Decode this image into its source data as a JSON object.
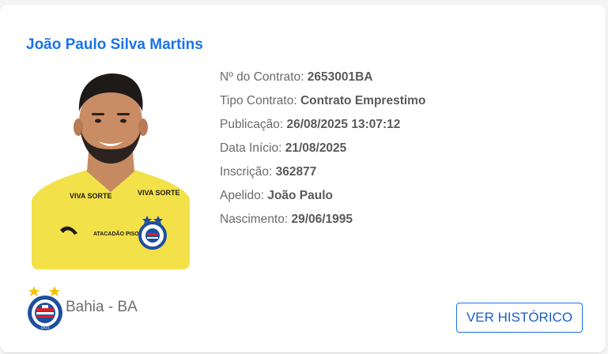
{
  "player": {
    "name": "João Paulo Silva Martins",
    "jersey_sponsor_1": "VIVA SORTE",
    "jersey_sponsor_2": "VIVA SORTE",
    "jersey_sponsor_3": "ATACADÃO PISOS"
  },
  "details": [
    {
      "label": "Nº do Contrato:",
      "value": "2653001BA"
    },
    {
      "label": "Tipo Contrato:",
      "value": "Contrato Emprestimo"
    },
    {
      "label": "Publicação:",
      "value": "26/08/2025 13:07:12"
    },
    {
      "label": "Data Início:",
      "value": "21/08/2025"
    },
    {
      "label": "Inscrição:",
      "value": "362877"
    },
    {
      "label": "Apelido:",
      "value": "João Paulo"
    },
    {
      "label": "Nascimento:",
      "value": "29/06/1995"
    }
  ],
  "club": {
    "name": "Bahia - BA",
    "badge_icon": "bahia-crest-icon",
    "badge_text": "ESPORTE CLUBE BAHIA",
    "badge_year": "1931"
  },
  "actions": {
    "history_label": "VER HISTÓRICO"
  },
  "colors": {
    "accent": "#1a73e8",
    "jersey": "#f3e14a",
    "club_blue": "#1d4fa0",
    "club_red": "#d8232a",
    "star": "#f2c200"
  }
}
